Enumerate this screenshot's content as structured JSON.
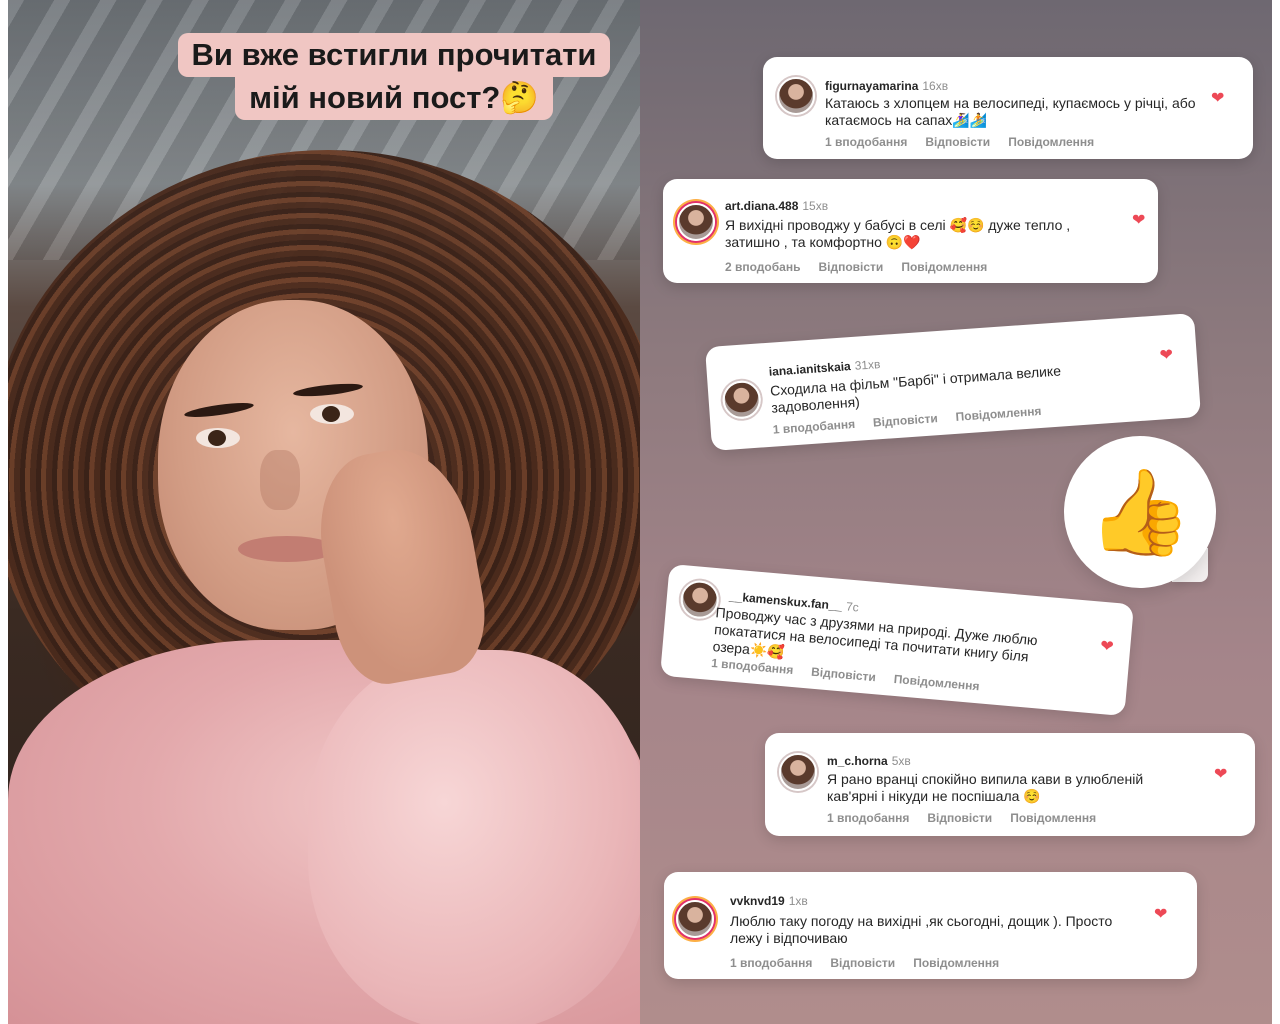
{
  "story": {
    "caption_line1": "Ви вже встигли прочитати",
    "caption_line2": "мій новий пост?🤔"
  },
  "comments": [
    {
      "username": "figurnayamarina",
      "time": "16хв",
      "text": "Катаюсь з хлопцем на велосипеді, купаємось у річці, або катаємось  на сапах🏄‍♀️🏄",
      "likes": "1 вподобання",
      "reply": "Відповісти",
      "message": "Повідомлення"
    },
    {
      "username": "art.diana.488",
      "time": "15хв",
      "text": "Я вихідні проводжу у бабусі в селі 🥰☺️ дуже тепло , затишно , та комфортно 🙃❤️",
      "likes": "2 вподобань",
      "reply": "Відповісти",
      "message": "Повідомлення"
    },
    {
      "username": "iana.ianitskaia",
      "time": "31хв",
      "text": "Сходила на  фільм \"Барбі\" і отримала велике задоволення)",
      "likes": "1 вподобання",
      "reply": "Відповісти",
      "message": "Повідомлення"
    },
    {
      "username": "__kamenskux.fan__",
      "time": "7с",
      "text": "Проводжу час з друзями на природі. Дуже люблю покататися на велосипеді та почитати книгу біля озера☀️🥰",
      "likes": "1 вподобання",
      "reply": "Відповісти",
      "message": "Повідомлення"
    },
    {
      "username": "m_c.horna",
      "time": "5хв",
      "text": "Я рано вранці спокійно випила кави в улюбленій кав'ярні і нікуди не поспішала ☺️",
      "likes": "1 вподобання",
      "reply": "Відповісти",
      "message": "Повідомлення"
    },
    {
      "username": "vvknvd19",
      "time": "1хв",
      "text": "Люблю таку погоду на вихідні ,як сьогодні, дощик ). Просто лежу і відпочиваю",
      "likes": "1 вподобання",
      "reply": "Відповісти",
      "message": "Повідомлення"
    }
  ],
  "icons": {
    "heart": "❤",
    "thumbs_up": "👍"
  },
  "colors": {
    "heart": "#ed4956",
    "caption_bg": "#f0c6c3",
    "meta_text": "#8e8e8e"
  }
}
